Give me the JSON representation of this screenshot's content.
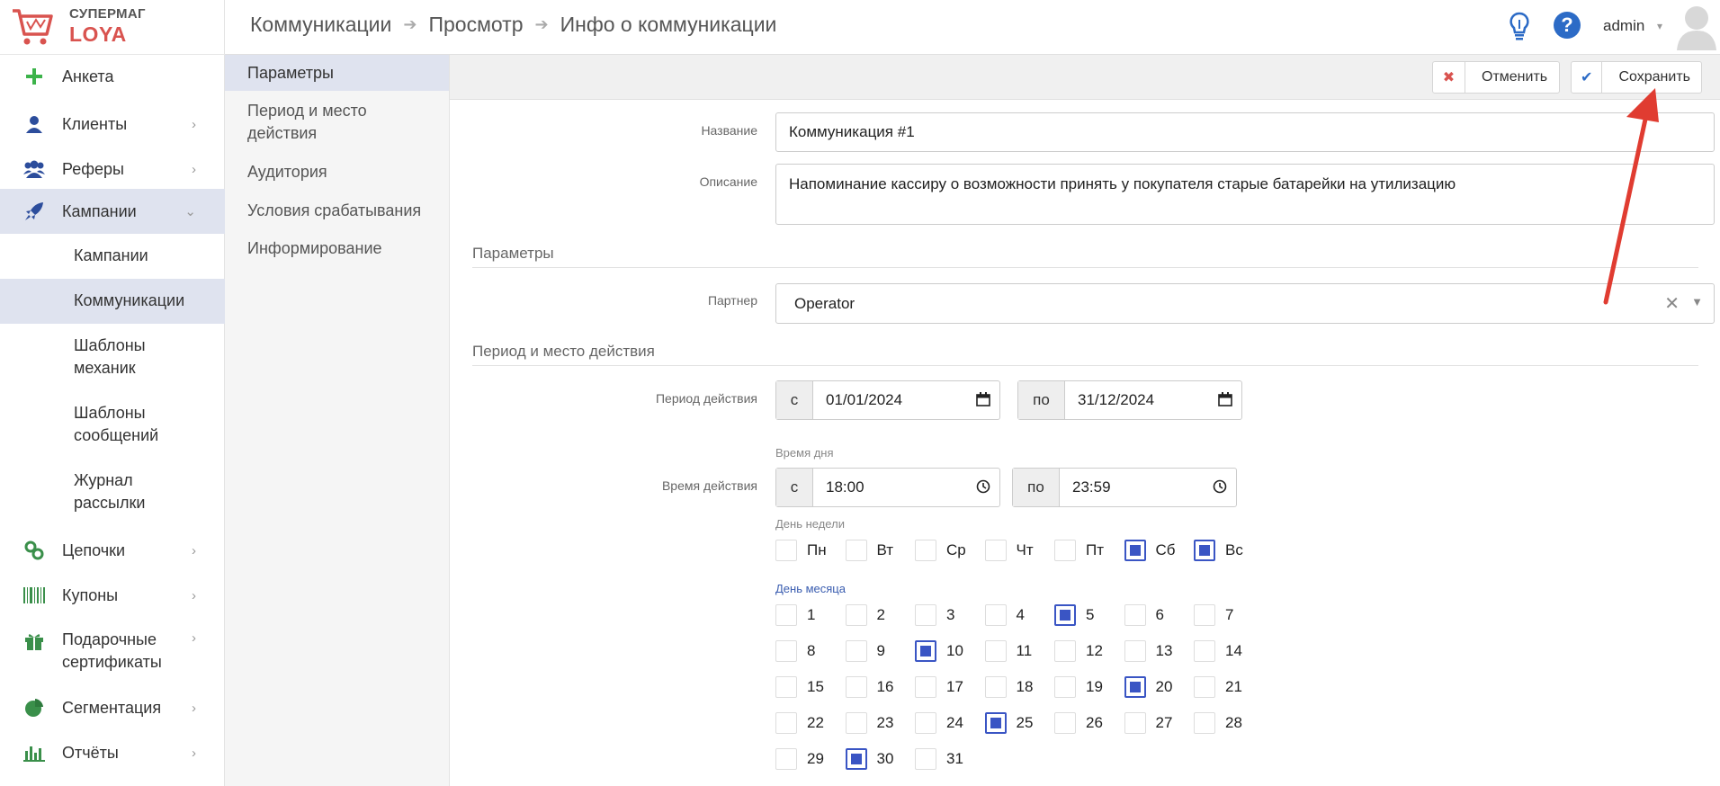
{
  "brand": {
    "line1": "СУПЕРМАГ",
    "line2": "LOYA"
  },
  "sidebar": {
    "items": [
      {
        "label": "Анкета",
        "icon": "plus-icon"
      },
      {
        "label": "Клиенты",
        "icon": "user-icon"
      },
      {
        "label": "Реферы",
        "icon": "users-icon"
      },
      {
        "label": "Кампании",
        "icon": "rocket-icon"
      },
      {
        "label": "Цепочки",
        "icon": "link-icon"
      },
      {
        "label": "Купоны",
        "icon": "barcode-icon"
      },
      {
        "label": "Подарочные сертификаты",
        "icon": "gift-icon"
      },
      {
        "label": "Сегментация",
        "icon": "pie-chart-icon"
      },
      {
        "label": "Отчёты",
        "icon": "bar-chart-icon"
      }
    ],
    "subitems": [
      {
        "label": "Кампании"
      },
      {
        "label": "Коммуникации"
      },
      {
        "label": "Шаблоны механик"
      },
      {
        "label": "Шаблоны сообщений"
      },
      {
        "label": "Журнал рассылки"
      }
    ]
  },
  "header": {
    "breadcrumb": [
      "Коммуникации",
      "Просмотр",
      "Инфо о коммуникации"
    ],
    "user": "admin"
  },
  "secnav": {
    "items": [
      {
        "label": "Параметры"
      },
      {
        "label": "Период и место действия"
      },
      {
        "label": "Аудитория"
      },
      {
        "label": "Условия срабатывания"
      },
      {
        "label": "Информирование"
      }
    ]
  },
  "toolbar": {
    "cancel_label": "Отменить",
    "save_label": "Сохранить"
  },
  "form": {
    "name_label": "Название",
    "name_value": "Коммуникация #1",
    "desc_label": "Описание",
    "desc_value": "Напоминание кассиру о возможности принять у покупателя старые батарейки на утилизацию",
    "params_title": "Параметры",
    "partner_label": "Партнер",
    "partner_value": "Operator",
    "period_title": "Период и место действия",
    "period_label": "Период действия",
    "from_addon": "с",
    "to_addon": "по",
    "date_from": "01/01/2024",
    "date_to": "31/12/2024",
    "time_caption": "Время дня",
    "time_label": "Время действия",
    "time_from": "18:00",
    "time_to": "23:59",
    "weekday_caption": "День недели",
    "weekdays": [
      {
        "label": "Пн",
        "checked": false
      },
      {
        "label": "Вт",
        "checked": false
      },
      {
        "label": "Ср",
        "checked": false
      },
      {
        "label": "Чт",
        "checked": false
      },
      {
        "label": "Пт",
        "checked": false
      },
      {
        "label": "Сб",
        "checked": true
      },
      {
        "label": "Вс",
        "checked": true
      }
    ],
    "monthday_caption": "День месяца",
    "monthdays_checked": [
      5,
      10,
      20,
      25,
      30
    ]
  },
  "colors": {
    "accent": "#3a55c4",
    "danger": "#d9534f",
    "active_bg": "#dfe3ef"
  }
}
